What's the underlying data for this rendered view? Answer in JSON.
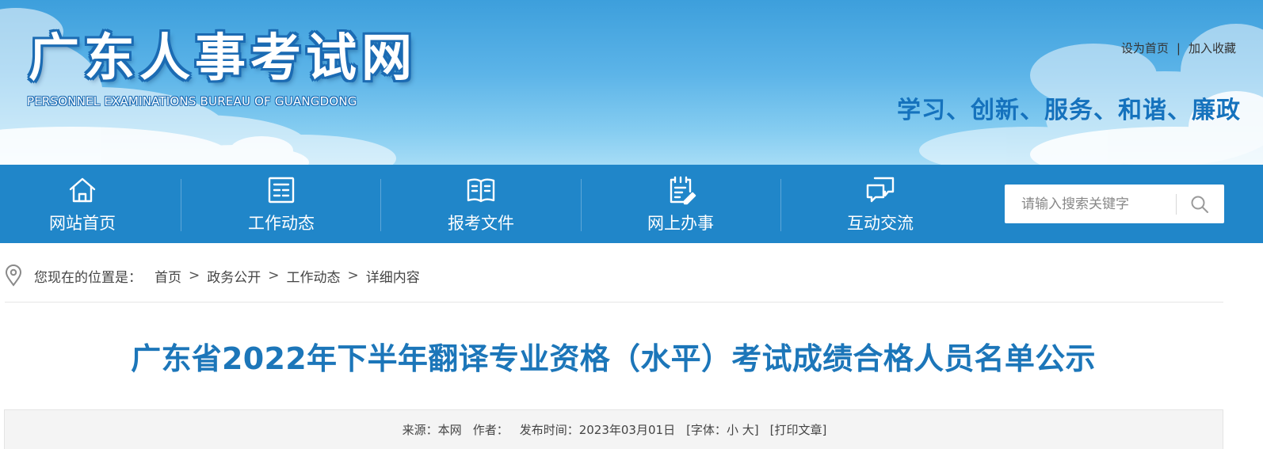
{
  "header": {
    "site_title": "广东人事考试网",
    "site_subtitle": "PERSONNEL EXAMINATIONS BUREAU OF GUANGDONG",
    "top_links": {
      "set_homepage": "设为首页",
      "separator": "|",
      "add_favorite": "加入收藏"
    },
    "slogan": "学习、创新、服务、和谐、廉政"
  },
  "nav": {
    "items": [
      {
        "label": "网站首页",
        "icon": "home-icon"
      },
      {
        "label": "工作动态",
        "icon": "news-icon"
      },
      {
        "label": "报考文件",
        "icon": "book-icon"
      },
      {
        "label": "网上办事",
        "icon": "clipboard-edit-icon"
      },
      {
        "label": "互动交流",
        "icon": "chat-bubbles-icon"
      }
    ],
    "search": {
      "placeholder": "请输入搜索关键字",
      "icon": "search-icon"
    }
  },
  "breadcrumb": {
    "prefix": "您现在的位置是：",
    "items": [
      "首页",
      "政务公开",
      "工作动态",
      "详细内容"
    ],
    "separator": ">"
  },
  "article": {
    "title": "广东省2022年下半年翻译专业资格（水平）考试成绩合格人员名单公示",
    "meta": {
      "source_label": "来源：",
      "source_value": "本网",
      "author_label": "作者：",
      "publish_label": "发布时间：",
      "publish_date": "2023年03月01日",
      "font_label": "[字体：",
      "font_small": "小",
      "font_large": "大",
      "font_close": "]",
      "print_label": "[打印文章]"
    }
  },
  "colors": {
    "nav_bg": "#2086c9",
    "title_blue": "#1c76b9",
    "slogan_blue": "#1572bd"
  }
}
